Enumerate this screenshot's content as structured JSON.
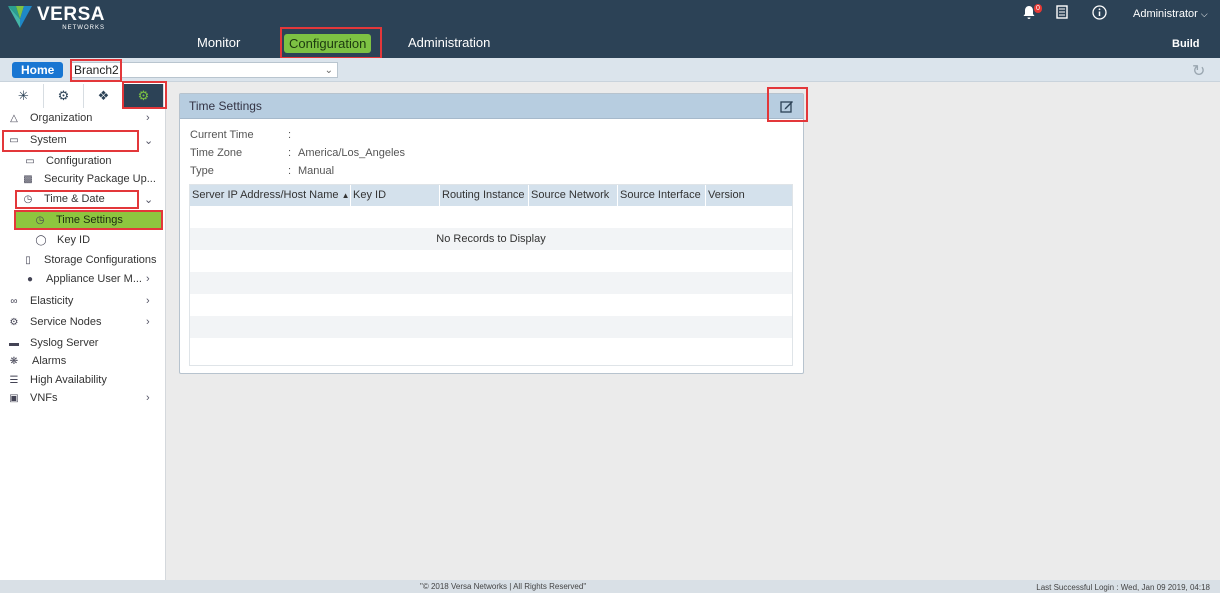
{
  "brand": {
    "name": "VERSA",
    "sub": "NETWORKS"
  },
  "nav": {
    "monitor": "Monitor",
    "configuration": "Configuration",
    "administration": "Administration",
    "build": "Build"
  },
  "header_right": {
    "notification_count": "0",
    "user": "Administrator"
  },
  "breadcrumb": {
    "home": "Home",
    "device": "Branch2"
  },
  "sidebar": {
    "tabs": [
      {
        "icon": "network-icon"
      },
      {
        "icon": "gear-icon"
      },
      {
        "icon": "cube-icon"
      },
      {
        "icon": "globe-gear-icon"
      }
    ],
    "items": [
      {
        "label": "Organization"
      },
      {
        "label": "System"
      },
      {
        "label": "Configuration"
      },
      {
        "label": "Security Package Up..."
      },
      {
        "label": "Time & Date"
      },
      {
        "label": "Time Settings"
      },
      {
        "label": "Key ID"
      },
      {
        "label": "Storage Configurations"
      },
      {
        "label": "Appliance User M..."
      },
      {
        "label": "Elasticity"
      },
      {
        "label": "Service Nodes"
      },
      {
        "label": "Syslog Server"
      },
      {
        "label": "Alarms"
      },
      {
        "label": "High Availability"
      },
      {
        "label": "VNFs"
      }
    ]
  },
  "panel": {
    "title": "Time Settings",
    "fields": [
      {
        "label": "Current Time",
        "sep": ":",
        "value": ""
      },
      {
        "label": "Time Zone",
        "sep": ":",
        "value": "America/Los_Angeles"
      },
      {
        "label": "Type",
        "sep": ":",
        "value": "Manual"
      }
    ],
    "table": {
      "columns": [
        "Server IP Address/Host Name",
        "Key ID",
        "Routing Instance",
        "Source Network",
        "Source Interface",
        "Version"
      ],
      "empty_text": "No Records to Display"
    }
  },
  "footer": {
    "copyright": "\"© 2018 Versa Networks | All Rights Reserved\"",
    "last_login": "Last Successful Login : Wed, Jan 09 2019, 04:18"
  }
}
